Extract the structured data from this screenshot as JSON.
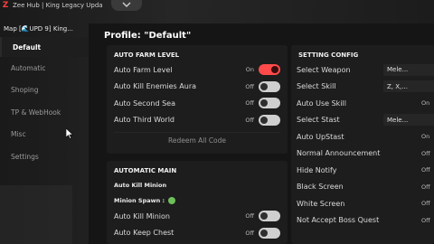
{
  "window": {
    "title": "Zee Hub | King Legacy Upda"
  },
  "map_label": "Map [🌊UPD 9] King...",
  "sidebar": {
    "items": [
      {
        "label": "Default"
      },
      {
        "label": "Automatic"
      },
      {
        "label": "Shoping"
      },
      {
        "label": "TP & WebHook"
      },
      {
        "label": "Misc"
      },
      {
        "label": "Settings"
      }
    ]
  },
  "main": {
    "profile_title": "Profile: \"Default\"",
    "auto_farm": {
      "header": "AUTO FARM LEVEL",
      "rows": [
        {
          "label": "Auto Farm Level",
          "state": "On",
          "on": true
        },
        {
          "label": "Auto Kill Enemies Aura",
          "state": "Off",
          "on": false
        },
        {
          "label": "Auto Second Sea",
          "state": "Off",
          "on": false
        },
        {
          "label": "Auto Third World",
          "state": "Off",
          "on": false
        }
      ],
      "redeem_label": "Redeem All Code"
    },
    "automatic_main": {
      "header": "AUTOMATIC MAIN",
      "kill_minion_label": "Auto Kill Minion",
      "minion_spawn_label": "Minion Spawn :",
      "rows": [
        {
          "label": "Auto Kill Minion",
          "state": "Off",
          "on": false
        },
        {
          "label": "Auto Keep Chest",
          "state": "Off",
          "on": false
        }
      ]
    },
    "setting_config": {
      "header": "SETTING CONFIG",
      "rows": [
        {
          "label": "Select Weapon",
          "value": "Mele..."
        },
        {
          "label": "Select Skill",
          "value": "Z, X,..."
        },
        {
          "label": "Auto Use Skill",
          "state": "On"
        },
        {
          "label": "Select Stast",
          "value": "Mele..."
        },
        {
          "label": "Auto UpStast",
          "state": "On"
        },
        {
          "label": "Normal Announcement",
          "state": "Off"
        },
        {
          "label": "Hide Notify",
          "state": "Off"
        },
        {
          "label": "Black Screen",
          "state": "Off"
        },
        {
          "label": "White Screen",
          "state": "Off"
        },
        {
          "label": "Not Accept Boss Quest",
          "state": "Off"
        }
      ]
    }
  },
  "colors": {
    "accent": "#ff4a4a",
    "status_green": "#6fbf5a"
  }
}
